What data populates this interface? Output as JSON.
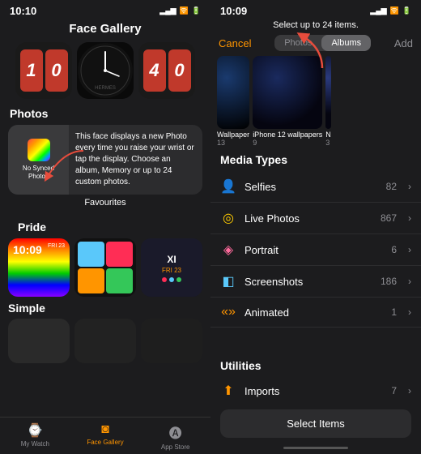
{
  "left": {
    "status": {
      "time": "10:10",
      "icons": "●●"
    },
    "header": "Face Gallery",
    "watch_faces": [
      {
        "id": "wf1",
        "type": "red-digit",
        "digits": [
          "1",
          "0"
        ]
      },
      {
        "id": "wf2",
        "type": "analog"
      },
      {
        "id": "wf3",
        "type": "red-digit-small",
        "digits": [
          "4",
          "0"
        ]
      }
    ],
    "sections": [
      {
        "label": "Photos",
        "tooltip": "This face displays a new Photo every time you raise your wrist or tap the display. Choose an album, Memory or up to 24 custom photos.",
        "no_synced": "No Synced Photos",
        "favourites": "Favourites"
      }
    ],
    "pride_label": "Pride",
    "simple_label": "Simple",
    "nav": [
      {
        "id": "my-watch",
        "icon": "⌚",
        "label": "My Watch",
        "active": false
      },
      {
        "id": "face-gallery",
        "icon": "🟠",
        "label": "Face Gallery",
        "active": true
      },
      {
        "id": "app-store",
        "icon": "🅐",
        "label": "App Store",
        "active": false
      }
    ]
  },
  "right": {
    "status": {
      "time": "10:09",
      "icons": "●●"
    },
    "select_hint": "Select up to 24 items.",
    "cancel_label": "Cancel",
    "add_label": "Add",
    "tabs": [
      {
        "id": "photos",
        "label": "Photos",
        "active": false
      },
      {
        "id": "albums",
        "label": "Albums",
        "active": true
      }
    ],
    "albums": [
      {
        "id": "wallpaper",
        "name": "Wallpaper",
        "count": "13"
      },
      {
        "id": "iphone12",
        "name": "iPhone 12 wallpapers",
        "count": "9"
      },
      {
        "id": "n",
        "name": "N",
        "count": "3"
      }
    ],
    "media_types_header": "Media Types",
    "media_items": [
      {
        "id": "selfies",
        "icon": "👤",
        "label": "Selfies",
        "count": "82"
      },
      {
        "id": "live-photos",
        "icon": "⦿",
        "label": "Live Photos",
        "count": "867"
      },
      {
        "id": "portrait",
        "icon": "◈",
        "label": "Portrait",
        "count": "6"
      },
      {
        "id": "screenshots",
        "icon": "◧",
        "label": "Screenshots",
        "count": "186"
      },
      {
        "id": "animated",
        "icon": "«»",
        "label": "Animated",
        "count": "1"
      }
    ],
    "utilities_header": "Utilities",
    "imports": {
      "label": "Imports",
      "count": "7"
    },
    "select_items_label": "Select Items"
  }
}
